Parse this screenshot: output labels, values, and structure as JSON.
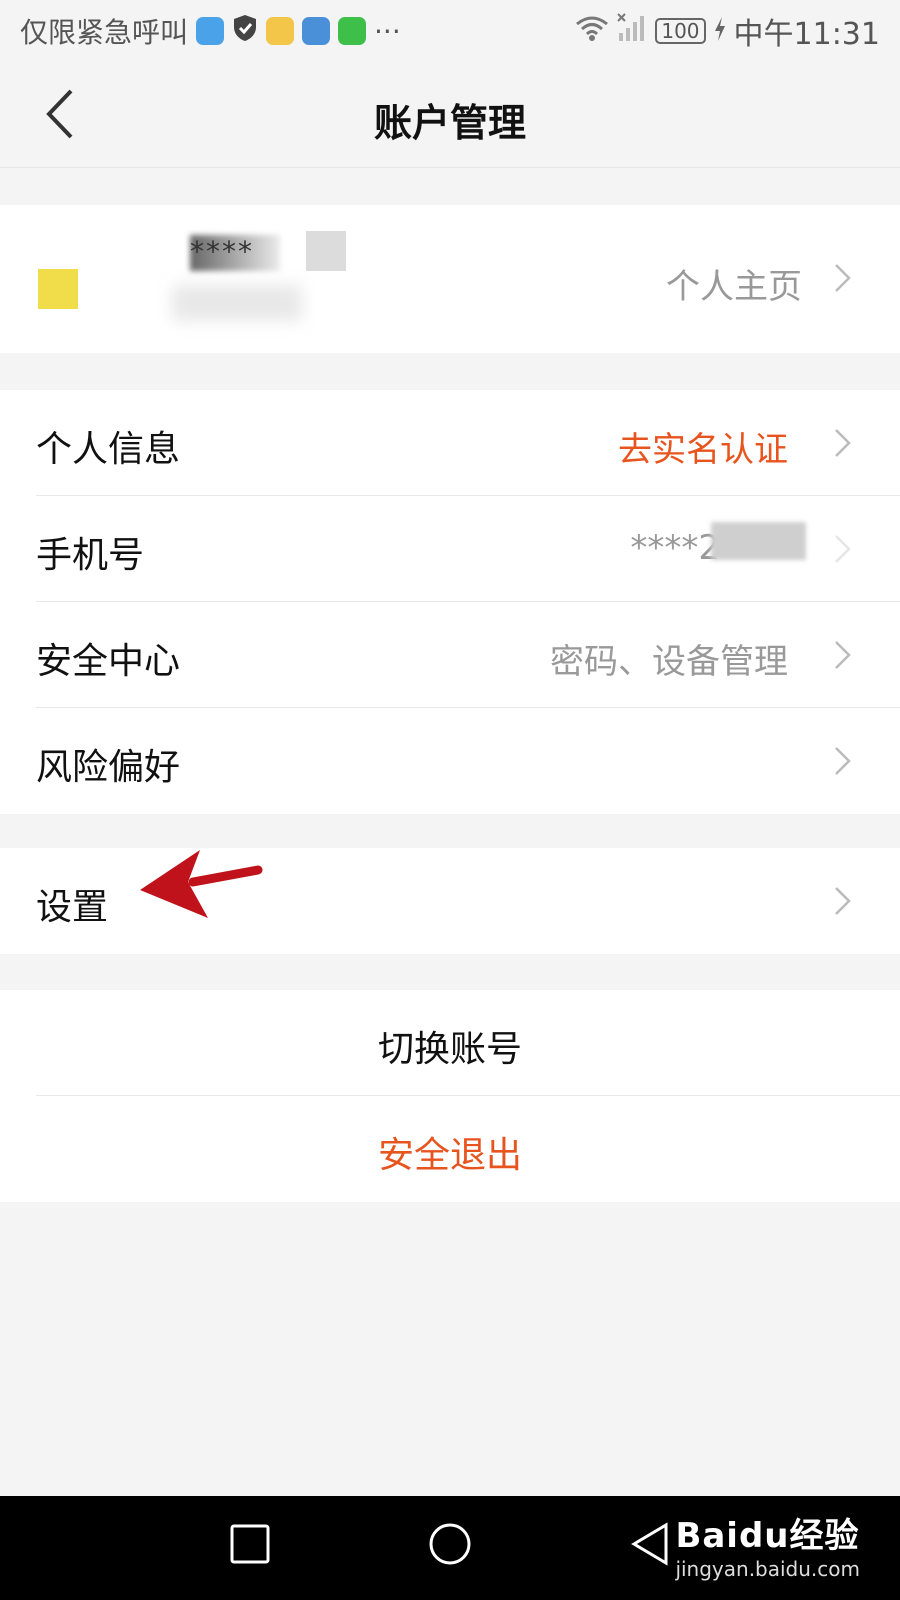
{
  "status_bar": {
    "carrier": "仅限紧急呼叫",
    "battery": "100",
    "time": "中午11:31",
    "more": "···"
  },
  "header": {
    "title": "账户管理"
  },
  "profile": {
    "masked_name": "****",
    "link_label": "个人主页"
  },
  "rows_group1": [
    {
      "label": "个人信息",
      "value": "去实名认证"
    },
    {
      "label": "手机号",
      "value": "****2"
    },
    {
      "label": "安全中心",
      "value": "密码、设备管理"
    },
    {
      "label": "风险偏好",
      "value": ""
    }
  ],
  "rows_group2": [
    {
      "label": "设置"
    }
  ],
  "actions": {
    "switch_account": "切换账号",
    "logout": "安全退出"
  },
  "watermark": {
    "brand": "Baidu经验",
    "url": "jingyan.baidu.com"
  },
  "colors": {
    "accent": "#e8541e",
    "annotation_arrow": "#c0121b",
    "avatar": "#f1dc4a"
  }
}
